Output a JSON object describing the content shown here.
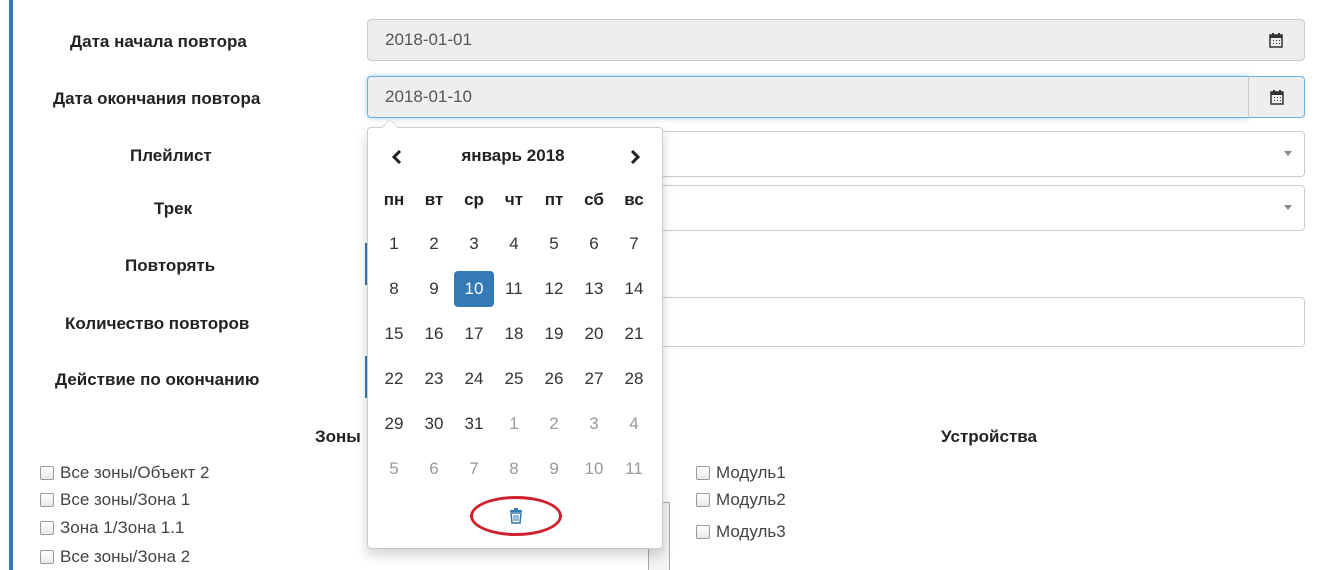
{
  "form": {
    "start_date": {
      "label": "Дата начала повтора",
      "value": "2018-01-01"
    },
    "end_date": {
      "label": "Дата окончания повтора",
      "value": "2018-01-10"
    },
    "playlist": {
      "label": "Плейлист"
    },
    "track": {
      "label": "Трек"
    },
    "repeat": {
      "label": "Повторять"
    },
    "repeat_count": {
      "label": "Количество повторов"
    },
    "end_action": {
      "label": "Действие по окончанию"
    }
  },
  "zones": {
    "title": "Зоны",
    "items": [
      "Все зоны/Объект 2",
      "Все зоны/Зона 1",
      "Зона 1/Зона 1.1",
      "Все зоны/Зона 2"
    ]
  },
  "devices": {
    "title": "Устройства",
    "items": [
      "Модуль1",
      "Модуль2",
      "Модуль3"
    ]
  },
  "datepicker": {
    "month_title": "январь 2018",
    "weekdays": [
      "пн",
      "вт",
      "ср",
      "чт",
      "пт",
      "сб",
      "вс"
    ],
    "weeks": [
      [
        "1",
        "2",
        "3",
        "4",
        "5",
        "6",
        "7"
      ],
      [
        "8",
        "9",
        "10",
        "11",
        "12",
        "13",
        "14"
      ],
      [
        "15",
        "16",
        "17",
        "18",
        "19",
        "20",
        "21"
      ],
      [
        "22",
        "23",
        "24",
        "25",
        "26",
        "27",
        "28"
      ],
      [
        "29",
        "30",
        "31",
        "1",
        "2",
        "3",
        "4"
      ],
      [
        "5",
        "6",
        "7",
        "8",
        "9",
        "10",
        "11"
      ]
    ],
    "selected_day": "10",
    "icons": {
      "prev": "chevron-left-icon",
      "next": "chevron-right-icon",
      "clear": "trash-icon"
    }
  },
  "colors": {
    "accent": "#337ab7",
    "highlight_circle": "#d0202b",
    "muted_day": "#999999"
  }
}
